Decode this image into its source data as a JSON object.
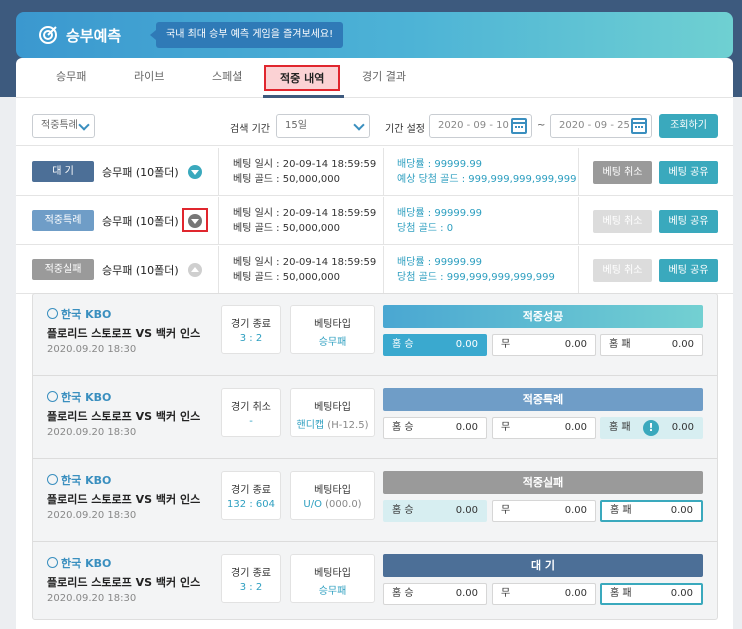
{
  "header": {
    "title": "승부예측",
    "tagline": "국내 최대 승부 예측 게임을 즐겨보세요!"
  },
  "tabs": [
    {
      "label": "승무패"
    },
    {
      "label": "라이브"
    },
    {
      "label": "스페셜"
    },
    {
      "label": "적중 내역",
      "active": true
    },
    {
      "label": "경기 결과"
    }
  ],
  "filter": {
    "type_value": "적중특례",
    "period_label": "검색 기간",
    "period_value": "15일",
    "range_label": "기간 설정",
    "date_from": "2020 - 09 - 10",
    "tilde": "~",
    "date_to": "2020 - 09 - 25",
    "search_button": "조회하기"
  },
  "bets": [
    {
      "status": "대 기",
      "status_color": "#4c6f97",
      "name": "승무패 (10폴더)",
      "toggle_color": "#3aa9bd",
      "date": "베팅 일시 : 20-09-14  18:59:59",
      "gold": "베팅 골드 : 50,000,000",
      "rate": "배당률 : 99999.99",
      "win": "예상 당첨 골드 : 999,999,999,999,999",
      "cancel": "베팅 취소",
      "cancel_color": "#9a9a9a",
      "share": "베팅 공유"
    },
    {
      "status": "적중특례",
      "status_color": "#6f9dc7",
      "name": "승무패 (10폴더)",
      "toggle_color": "#777777",
      "date": "베팅 일시 : 20-09-14  18:59:59",
      "gold": "베팅 골드 : 50,000,000",
      "rate": "배당률 : 99999.99",
      "win": "당첨 골드 : 0",
      "cancel": "베팅 취소",
      "cancel_color": "#dcdcdc",
      "share": "베팅 공유"
    },
    {
      "status": "적중실패",
      "status_color": "#9a9a9a",
      "name": "승무패 (10폴더)",
      "toggle_color": "#cfcfcf",
      "date": "베팅 일시 : 20-09-14  18:59:59",
      "gold": "베팅 골드 : 50,000,000",
      "rate": "배당률 : 99999.99",
      "win": "당첨 골드 : 999,999,999,999,999",
      "cancel": "베팅 취소",
      "cancel_color": "#dcdcdc",
      "share": "베팅 공유"
    }
  ],
  "matches": [
    {
      "league": "한국 KBO",
      "teams": "플로리드 스토로프  VS  백커 인스",
      "date": "2020.09.20  18:30",
      "game_label": "경기 종료",
      "game_value": "3 : 2",
      "type_label": "베팅타입",
      "type_value": "승무패",
      "type_extra": "",
      "result": "적중성공",
      "result_color": "#5fc0d6",
      "odds": [
        {
          "k": "홈 승",
          "v": "0.00"
        },
        {
          "k": "무",
          "v": "0.00"
        },
        {
          "k": "홈 패",
          "v": "0.00"
        }
      ]
    },
    {
      "league": "한국 KBO",
      "teams": "플로리드 스토로프  VS  백커 인스",
      "date": "2020.09.20  18:30",
      "game_label": "경기 취소",
      "game_value": "-",
      "type_label": "베팅타입",
      "type_value": "핸디캡",
      "type_extra": " (H-12.5)",
      "result": "적중특례",
      "result_color": "#6f9dc7",
      "odds": [
        {
          "k": "홈 승",
          "v": "0.00"
        },
        {
          "k": "무",
          "v": "0.00"
        },
        {
          "k": "홈 패",
          "v": "0.00"
        }
      ],
      "warn": "!"
    },
    {
      "league": "한국 KBO",
      "teams": "플로리드 스토로프  VS  백커 인스",
      "date": "2020.09.20  18:30",
      "game_label": "경기 종료",
      "game_value": "132 : 604",
      "type_label": "베팅타입",
      "type_value": "U/O",
      "type_extra": " (000.0)",
      "result": "적중실패",
      "result_color": "#9a9a9a",
      "odds": [
        {
          "k": "홈 승",
          "v": "0.00"
        },
        {
          "k": "무",
          "v": "0.00"
        },
        {
          "k": "홈 패",
          "v": "0.00"
        }
      ]
    },
    {
      "league": "한국 KBO",
      "teams": "플로리드 스토로프  VS  백커 인스",
      "date": "2020.09.20  18:30",
      "game_label": "경기 종료",
      "game_value": "3 : 2",
      "type_label": "베팅타입",
      "type_value": "승무패",
      "type_extra": "",
      "result": "대 기",
      "result_color": "#4c6f97",
      "odds": [
        {
          "k": "홈 승",
          "v": "0.00"
        },
        {
          "k": "무",
          "v": "0.00"
        },
        {
          "k": "홈 패",
          "v": "0.00"
        }
      ]
    }
  ]
}
